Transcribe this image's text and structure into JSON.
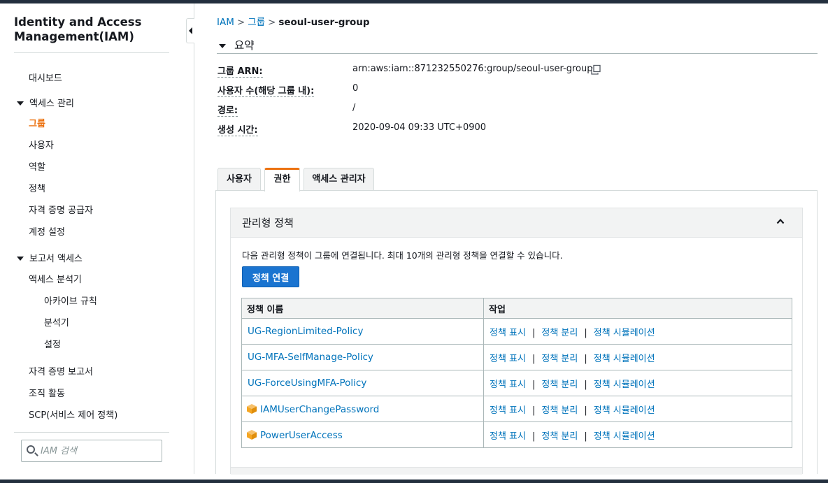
{
  "sidebar": {
    "title": "Identity and Access Management(IAM)",
    "dashboard": "대시보드",
    "access_mgmt": {
      "label": "액세스 관리",
      "items": [
        "그룹",
        "사용자",
        "역할",
        "정책",
        "자격 증명 공급자",
        "계정 설정"
      ]
    },
    "reports_access": {
      "label": "보고서 액세스",
      "analyzer": "액세스 분석기",
      "sub_items": [
        "아카이브 규칙",
        "분석기",
        "설정"
      ],
      "items": [
        "자격 증명 보고서",
        "조직 활동",
        "SCP(서비스 제어 정책)"
      ]
    },
    "search_placeholder": "IAM 검색"
  },
  "breadcrumb": {
    "root": "IAM",
    "sep": ">",
    "middle": "그룹",
    "current": "seoul-user-group"
  },
  "summary": {
    "heading": "요약",
    "rows": [
      {
        "label": "그룹 ARN:",
        "value": "arn:aws:iam::871232550276:group/seoul-user-group"
      },
      {
        "label": "사용자 수(해당 그룹 내):",
        "value": "0"
      },
      {
        "label": "경로:",
        "value": "/"
      },
      {
        "label": "생성 시간:",
        "value": "2020-09-04 09:33 UTC+0900"
      }
    ]
  },
  "tabs": [
    "사용자",
    "권한",
    "액세스 관리자"
  ],
  "active_tab": "권한",
  "managed_policies": {
    "title": "관리형 정책",
    "description": "다음 관리형 정책이 그룹에 연결됩니다. 최대 10개의 관리형 정책을 연결할 수 있습니다.",
    "attach_button": "정책 연결",
    "columns": [
      "정책 이름",
      "작업"
    ],
    "actions": {
      "show": "정책 표시",
      "detach": "정책 분리",
      "simulate": "정책 시뮬레이션",
      "sep": "|"
    },
    "rows": [
      {
        "name": "UG-RegionLimited-Policy",
        "aws_managed": false
      },
      {
        "name": "UG-MFA-SelfManage-Policy",
        "aws_managed": false
      },
      {
        "name": "UG-ForceUsingMFA-Policy",
        "aws_managed": false
      },
      {
        "name": "IAMUserChangePassword",
        "aws_managed": true
      },
      {
        "name": "PowerUserAccess",
        "aws_managed": true
      }
    ]
  },
  "colors": {
    "link": "#0073bb",
    "active_nav": "#ec7211",
    "primary_button": "#1a74d0",
    "aws_box_icon": "#f5a623"
  }
}
